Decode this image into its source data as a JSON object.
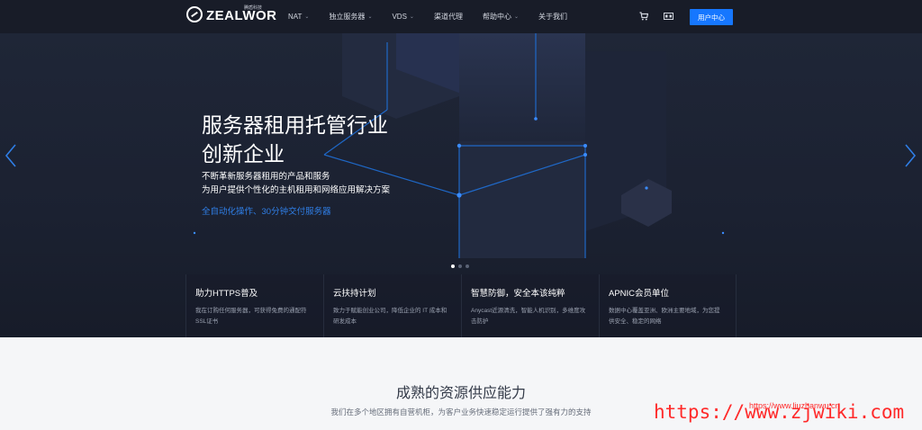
{
  "nav": {
    "logo_text": "ZEALWOR",
    "logo_sub": "腾盾科技",
    "items": [
      {
        "label": "NAT",
        "has_caret": true
      },
      {
        "label": "独立服务器",
        "has_caret": true
      },
      {
        "label": "VDS",
        "has_caret": true
      },
      {
        "label": "渠道代理",
        "has_caret": false
      },
      {
        "label": "帮助中心",
        "has_caret": true
      },
      {
        "label": "关于我们",
        "has_caret": false
      }
    ],
    "cart_icon": "cart-icon",
    "lang_icon": "language-icon",
    "user_button": "用户中心"
  },
  "hero": {
    "title_line1": "服务器租用托管行业",
    "title_line2": "创新企业",
    "desc_line1": "不断革新服务器租用的产品和服务",
    "desc_line2": "为用户提供个性化的主机租用和网络应用解决方案",
    "highlight": "全自动化操作、30分钟交付服务器",
    "slides": 3,
    "active_slide": 1
  },
  "features": [
    {
      "title": "助力HTTPS普及",
      "desc": "我在订购任何服务器，可获得免费的通配符SSL证书"
    },
    {
      "title": "云扶持计划",
      "desc": "致力于赋能创业公司，降低企业的 IT 成本和研发成本"
    },
    {
      "title": "智慧防御，安全本该纯粹",
      "desc": "Anycast近源清洗，智能人机识别，多维度攻击防护"
    },
    {
      "title": "APNIC会员单位",
      "desc": "数据中心覆盖亚洲、欧洲主要地域，为您提供安全、稳定的网络"
    }
  ],
  "section": {
    "title": "成熟的资源供应能力",
    "subtitle": "我们在多个地区拥有自营机柜，为客户业务快速稳定运行提供了强有力的支持"
  },
  "watermark": {
    "text": "https://www.zjwiki.com",
    "small": "https://www.liuzhanwu.cn"
  },
  "colors": {
    "nav_bg": "#181c28",
    "hero_bg": "#1f2637",
    "accent": "#1677ff",
    "highlight": "#2f7ee6",
    "watermark": "#ff2a2a"
  }
}
